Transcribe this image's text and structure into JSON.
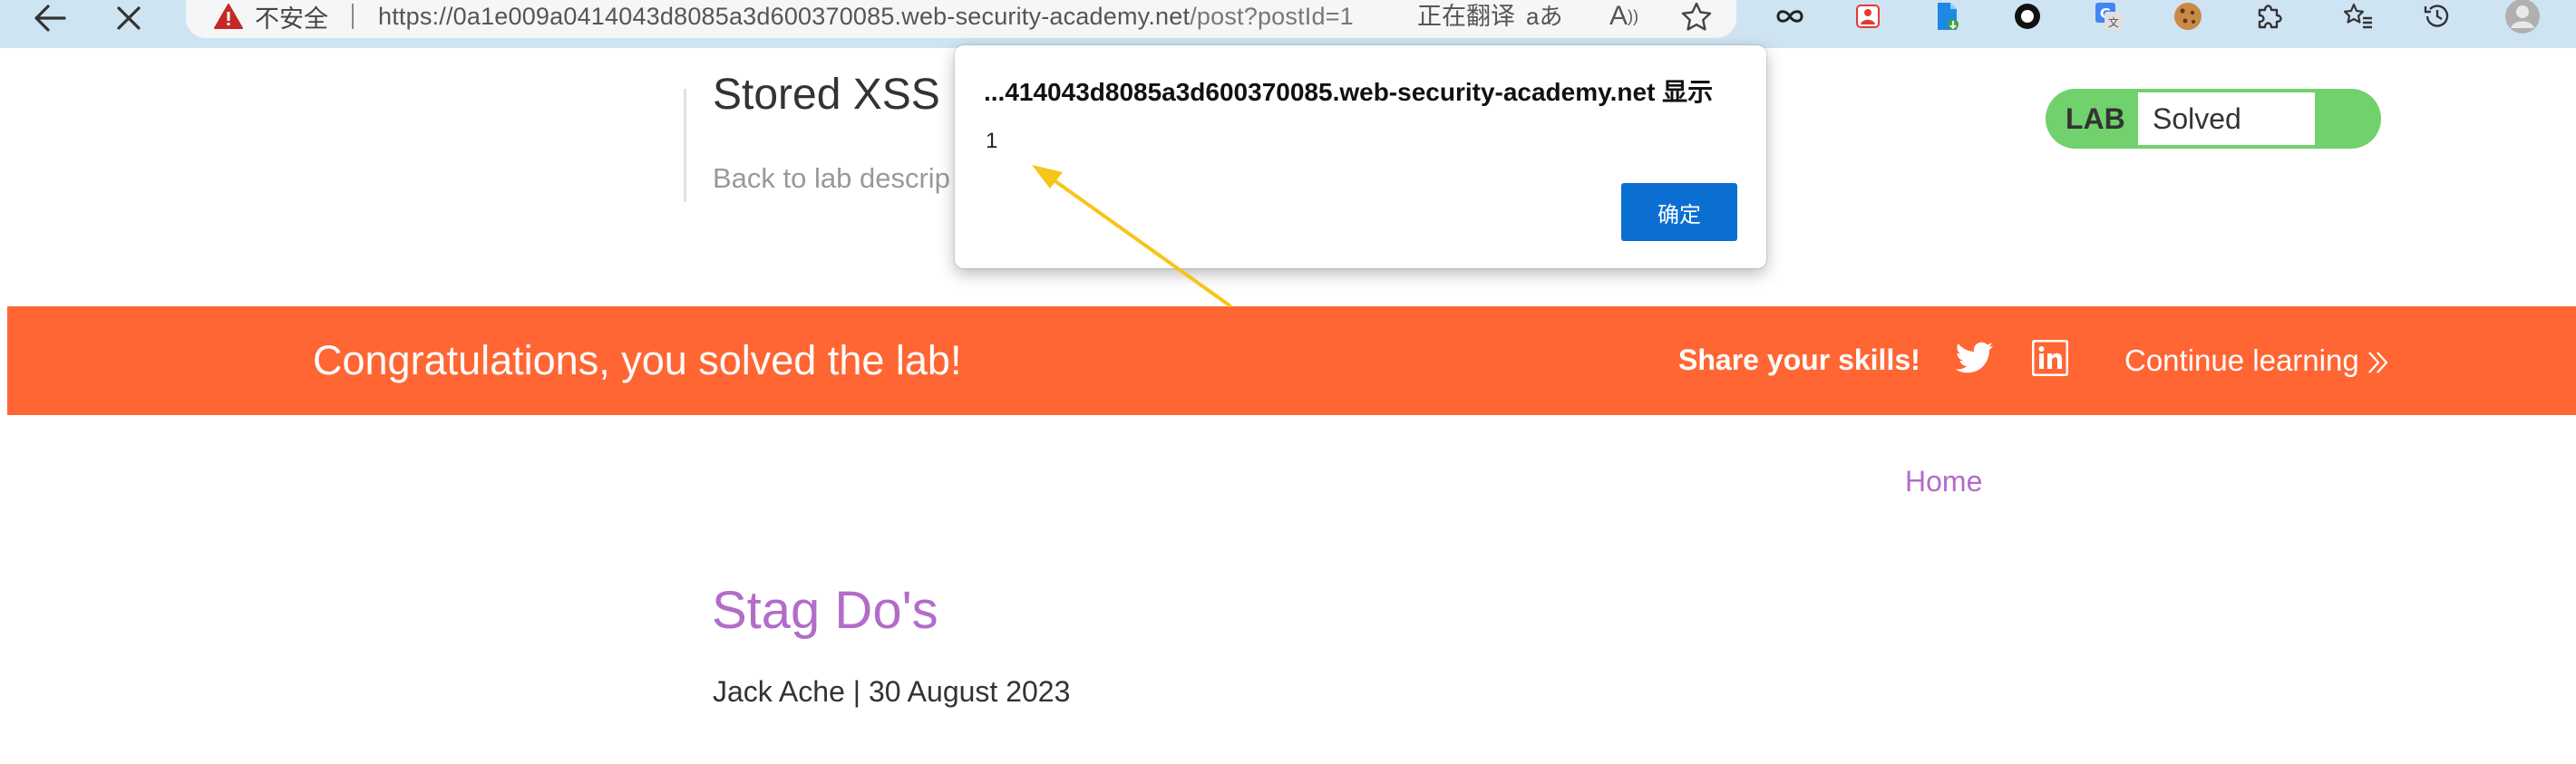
{
  "browser": {
    "security_warning": "不安全",
    "url_host": "https://0a1e009a0414043d8085a3d600370085.web-security-academy.net",
    "url_path": "/post?postId=1",
    "translating_text": "正在翻译",
    "read_aloud_label": "aあ",
    "read_mode_label": "A"
  },
  "lab_header": {
    "title": "Stored XSS",
    "back_link": "Back to lab descrip",
    "status_label": "LAB",
    "status_value": "Solved"
  },
  "banner": {
    "congrats_text": "Congratulations, you solved the lab!",
    "share_text": "Share your skills!",
    "continue_text": "Continue learning"
  },
  "blog": {
    "home_link": "Home",
    "post_title": "Stag Do's",
    "post_meta": "Jack Ache | 30 August 2023"
  },
  "alert": {
    "title": "...414043d8085a3d600370085.web-security-academy.net 显示",
    "message": "1",
    "ok_label": "确定"
  },
  "colors": {
    "banner": "#ff6633",
    "lab_solved": "#70d16d",
    "link_purple": "#b26cc9",
    "dialog_button": "#0b6fd1",
    "annotation_arrow": "#f5c518",
    "chrome_bar": "#cfe4f3"
  },
  "icons": {
    "toolbar": [
      "back-arrow-icon",
      "close-icon",
      "warning-triangle-icon",
      "favorite-star-icon",
      "infinity-icon",
      "people-icon",
      "file-download-icon",
      "record-circle-icon",
      "translate-icon",
      "cookie-icon",
      "puzzle-extension-icon",
      "favorites-list-icon",
      "history-icon",
      "profile-avatar-icon"
    ],
    "banner": [
      "twitter-icon",
      "linkedin-icon",
      "double-chevron-right-icon"
    ]
  }
}
